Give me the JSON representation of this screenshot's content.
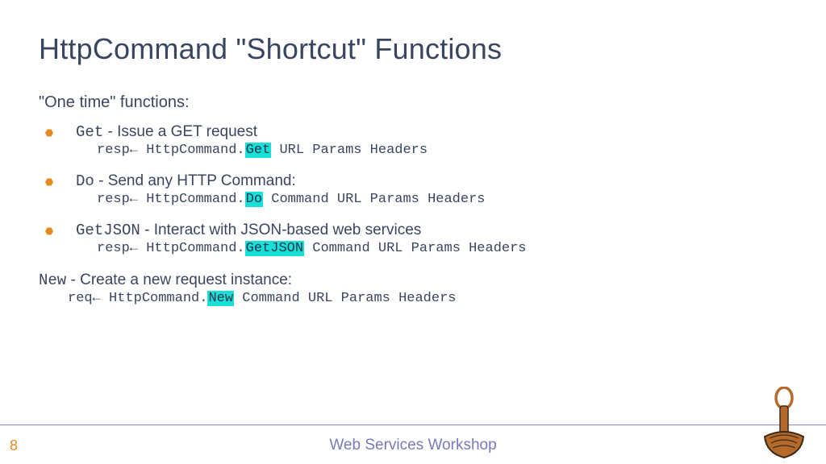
{
  "title": "HttpCommand \"Shortcut\" Functions",
  "sectionLabel": "\"One time\" functions:",
  "items": [
    {
      "name": "Get",
      "desc": " - Issue a GET request",
      "codePre": "resp← HttpCommand.",
      "codeHl": "Get",
      "codePost": " URL Params Headers"
    },
    {
      "name": "Do",
      "desc": " - Send any HTTP Command:",
      "codePre": "resp← HttpCommand.",
      "codeHl": "Do",
      "codePost": " Command URL Params Headers"
    },
    {
      "name": "GetJSON",
      "desc": " - Interact with JSON-based web services",
      "codePre": "resp← HttpCommand.",
      "codeHl": "GetJSON",
      "codePost": " Command URL Params Headers"
    }
  ],
  "newBlock": {
    "name": "New",
    "desc": " - Create a new request instance:",
    "codePre": "req← HttpCommand.",
    "codeHl": "New",
    "codePost": " Command URL Params Headers"
  },
  "footer": {
    "page": "8",
    "title": "Web Services Workshop"
  }
}
